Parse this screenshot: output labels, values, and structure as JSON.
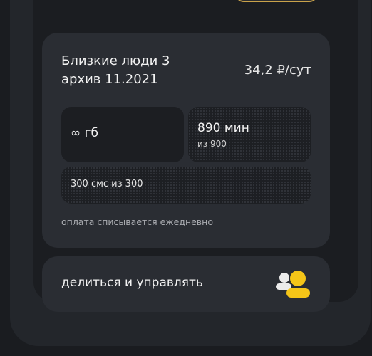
{
  "tariff": {
    "name_line1": "Близкие люди 3",
    "name_line2": "архив 11.2021",
    "price": "34,2 ₽/сут"
  },
  "balances": {
    "data_amount": "∞ гб",
    "minutes_left": "890 мин",
    "minutes_total": "из 900",
    "sms": "300 смс из 300"
  },
  "payment_note": "оплата списывается ежедневно",
  "share": {
    "label": "делиться и управлять",
    "icon": "people-share-icon"
  },
  "colors": {
    "accent": "#f5c518",
    "card": "#2a2d33",
    "tile": "#1c1e22"
  }
}
